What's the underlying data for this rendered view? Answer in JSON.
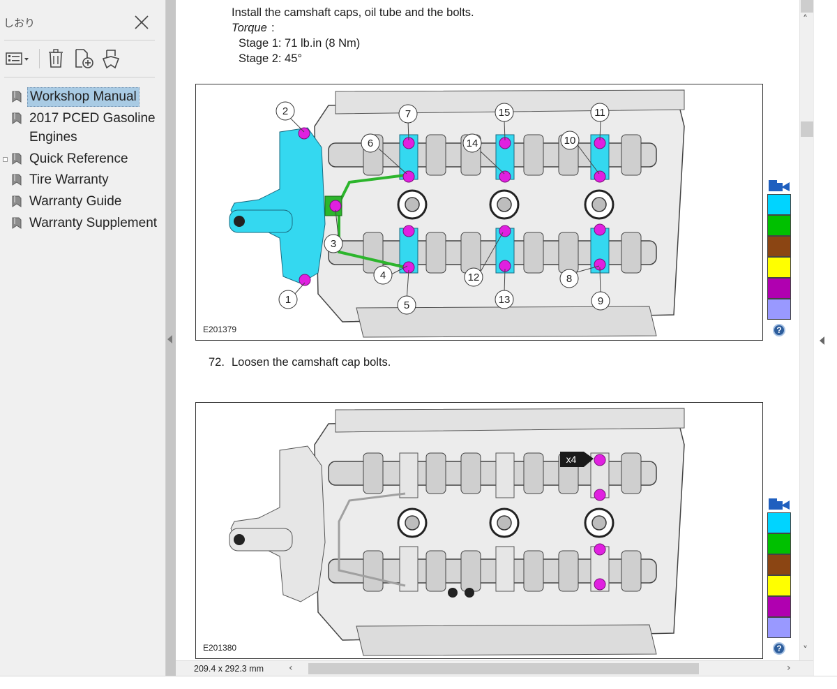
{
  "sidebar": {
    "title": "しおり",
    "bookmarks": [
      {
        "label": "Workshop Manual"
      },
      {
        "label": "2017 PCED Gasoline"
      },
      {
        "label": "Engines"
      },
      {
        "label": "Quick Reference"
      },
      {
        "label": "Tire Warranty"
      },
      {
        "label": "Warranty Guide"
      },
      {
        "label": "Warranty Supplement"
      }
    ]
  },
  "document": {
    "step_text": "Install the camshaft caps, oil tube and the bolts.",
    "torque_label": "Torque",
    "torque_colon": ":",
    "stage1": "Stage 1:  71 lb.in (8 Nm)",
    "stage2": "Stage 2:  45°",
    "step72_number": "72.",
    "step72_text": "Loosen the camshaft cap bolts.",
    "figure1": {
      "label": "E201379",
      "callouts": [
        "1",
        "2",
        "3",
        "4",
        "5",
        "6",
        "7",
        "8",
        "9",
        "10",
        "11",
        "12",
        "13",
        "14",
        "15"
      ]
    },
    "figure2": {
      "label": "E201380",
      "multiplier": "x4"
    },
    "help_glyph": "?",
    "swatch_colors": [
      "#00d4ff",
      "#00c000",
      "#8b4513",
      "#ffff00",
      "#b000b0",
      "#9999ff"
    ],
    "accent_bolt_color": "#e020e0",
    "cap_highlight_color": "#34d8f0"
  },
  "status": {
    "page_size": "209.4 x 292.3 mm"
  }
}
